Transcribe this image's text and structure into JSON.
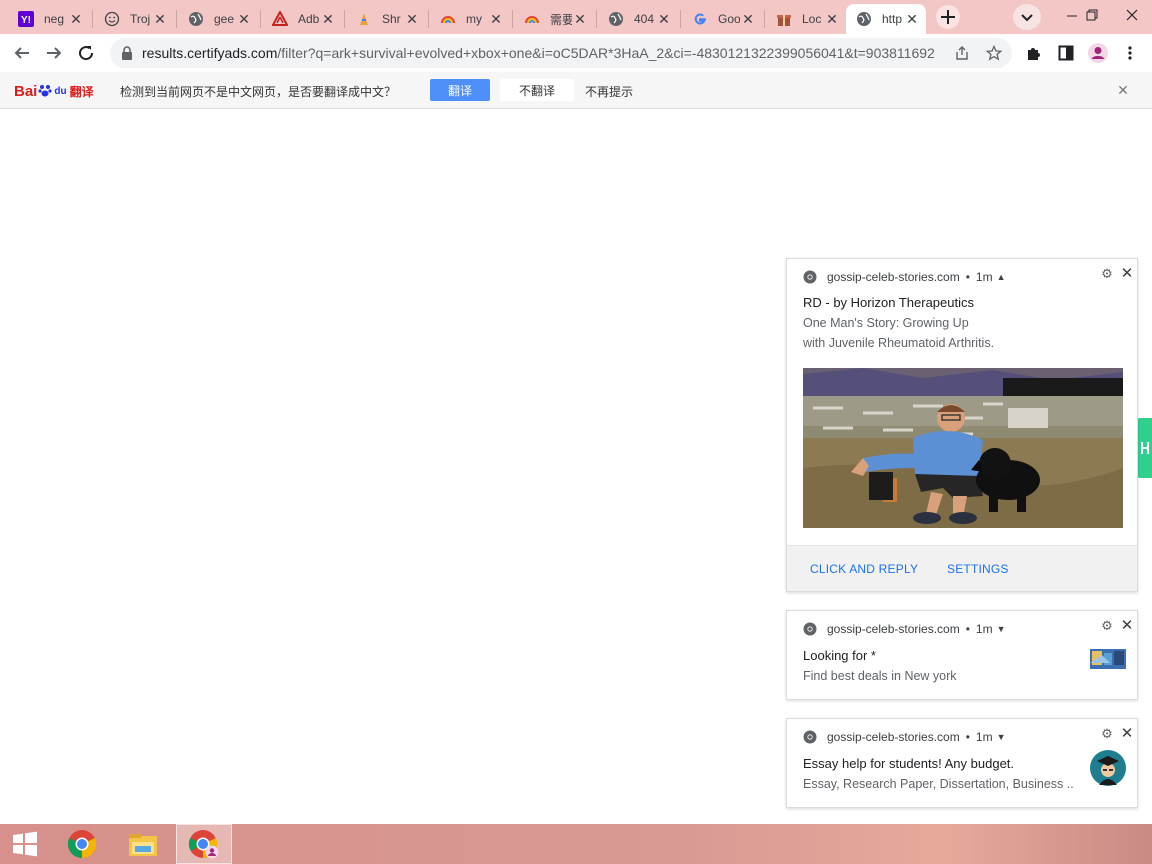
{
  "browser": {
    "tabs": [
      {
        "title": "neg",
        "icon": "yahoo-icon"
      },
      {
        "title": "Troj",
        "icon": "smiley-icon"
      },
      {
        "title": "gee",
        "icon": "globe-icon"
      },
      {
        "title": "Adb",
        "icon": "adblock-icon"
      },
      {
        "title": "Shr",
        "icon": "shrimp-icon"
      },
      {
        "title": "my",
        "icon": "rainbow-icon"
      },
      {
        "title": "需要",
        "icon": "rainbow-icon"
      },
      {
        "title": "404",
        "icon": "globe-icon"
      },
      {
        "title": "Goo",
        "icon": "google-icon"
      },
      {
        "title": "Loc",
        "icon": "gift-icon"
      },
      {
        "title": "http",
        "icon": "globe-icon",
        "active": true
      }
    ],
    "address": {
      "host": "results.certifyads.com",
      "path": "/filter?q=ark+survival+evolved+xbox+one&i=oC5DAR*3HaA_2&ci=-4830121322399056041&t=903811692"
    }
  },
  "translate_bar": {
    "logo_text_1": "Bai",
    "logo_text_2": "du",
    "logo_text_3": "翻译",
    "message": "检测到当前网页不是中文网页，是否要翻译成中文？",
    "translate_label": "翻译",
    "no_translate_label": "不翻译",
    "never_label": "不再提示"
  },
  "notifications": [
    {
      "site": "gossip-celeb-stories.com",
      "time": "1m",
      "title": "RD - by Horizon Therapeutics",
      "body_line1": "One Man's Story: Growing Up",
      "body_line2": "with Juvenile Rheumatoid Arthritis.",
      "action1": "CLICK AND REPLY",
      "action2": "SETTINGS"
    },
    {
      "site": "gossip-celeb-stories.com",
      "time": "1m",
      "title": "Looking for *",
      "body_line1": "Find best deals in New york"
    },
    {
      "site": "gossip-celeb-stories.com",
      "time": "1m",
      "title": "Essay help for students! Any budget.",
      "body_line1": "Essay, Research Paper, Dissertation, Business ..."
    }
  ],
  "colors": {
    "tabstrip": "#f4c7c7",
    "link_blue": "#1a73e8",
    "translate_button": "#4e8ef7",
    "taskbar": "#d7908b"
  }
}
